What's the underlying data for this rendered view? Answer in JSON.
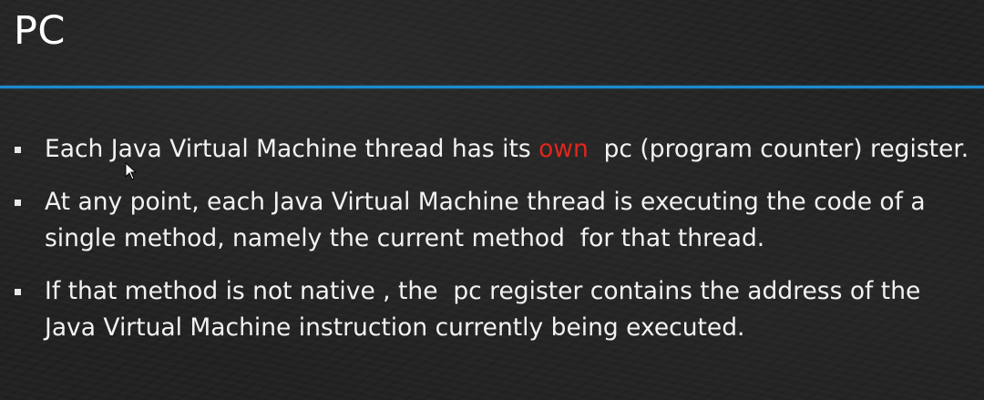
{
  "slide": {
    "title": "PC",
    "bullets": [
      {
        "text_before": "Each Java Virtual Machine thread has its ",
        "highlight": "own",
        "text_after": "  pc (program counter) register."
      },
      {
        "text": "At any point, each Java Virtual Machine thread is executing the code of a single method, namely the current method  for that thread."
      },
      {
        "text": "If that method is not native , the  pc register contains the address of the Java Virtual Machine instruction currently being executed."
      }
    ]
  },
  "colors": {
    "accent_line": "#1d8ad0",
    "highlight_text": "#e0261d",
    "body_text": "#f2f2f2"
  },
  "icons": {
    "cursor": "mouse-pointer-icon",
    "bullet": "square-bullet"
  }
}
